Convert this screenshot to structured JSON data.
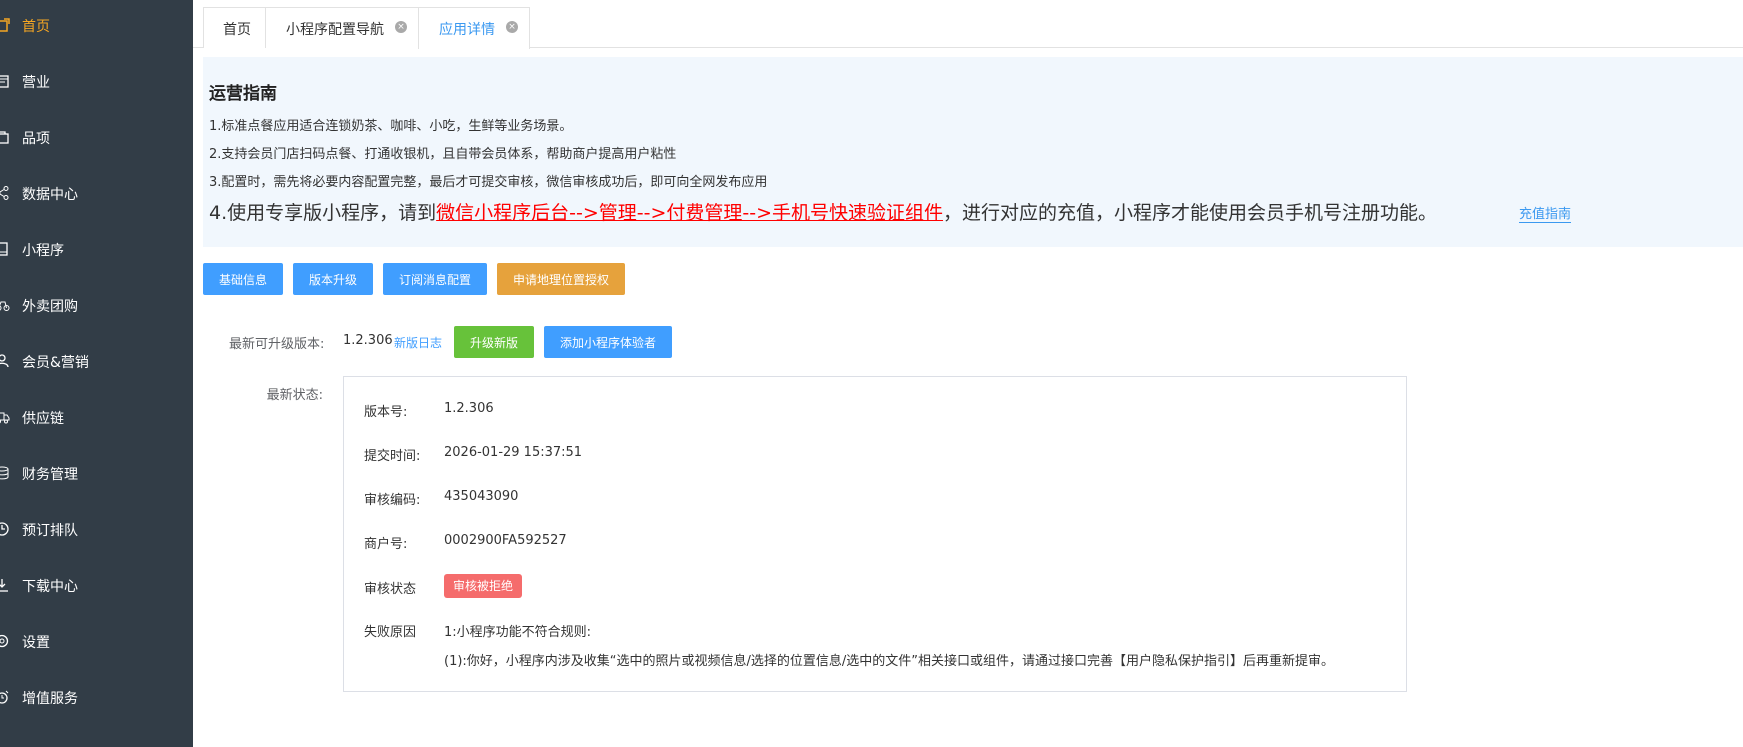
{
  "sidebar": {
    "items": [
      {
        "label": "首页",
        "icon": "home-icon",
        "active": true
      },
      {
        "label": "营业",
        "icon": "calendar-icon"
      },
      {
        "label": "品项",
        "icon": "bag-icon"
      },
      {
        "label": "数据中心",
        "icon": "share-icon"
      },
      {
        "label": "小程序",
        "icon": "phone-icon"
      },
      {
        "label": "外卖团购",
        "icon": "bike-icon"
      },
      {
        "label": "会员&营销",
        "icon": "user-icon"
      },
      {
        "label": "供应链",
        "icon": "truck-icon"
      },
      {
        "label": "财务管理",
        "icon": "coins-icon"
      },
      {
        "label": "预订排队",
        "icon": "clock-icon"
      },
      {
        "label": "下载中心",
        "icon": "download-icon"
      },
      {
        "label": "设置",
        "icon": "gear-icon"
      },
      {
        "label": "增值服务",
        "icon": "alarm-icon"
      }
    ]
  },
  "tabs": [
    {
      "label": "首页"
    },
    {
      "label": "小程序配置导航",
      "close": "×"
    },
    {
      "label": "应用详情",
      "close": "×"
    }
  ],
  "guide": {
    "title": "运营指南",
    "line1": "1.标准点餐应用适合连锁奶茶、咖啡、小吃，生鲜等业务场景。",
    "line2": "2.支持会员门店扫码点餐、打通收银机，且自带会员体系，帮助商户提高用户粘性",
    "line3": "3.配置时，需先将必要内容配置完整，最后才可提交审核，微信审核成功后，即可向全网发布应用",
    "line4_prefix": "4.使用专享版小程序，请到",
    "line4_red": "微信小程序后台-->管理-->付费管理-->手机号快速验证组件",
    "line4_suffix": "，进行对应的充值，小程序才能使用会员手机号注册功能。",
    "recharge_link": "充值指南"
  },
  "actions": {
    "basic_info": "基础信息",
    "version_upgrade": "版本升级",
    "subscribe_msg": "订阅消息配置",
    "apply_location": "申请地理位置授权"
  },
  "version": {
    "label": "最新可升级版本:",
    "value": "1.2.306",
    "changelog": "新版日志",
    "upgrade_btn": "升级新版",
    "add_tester_btn": "添加小程序体验者"
  },
  "status": {
    "label": "最新状态:",
    "version_no_k": "版本号:",
    "version_no_v": "1.2.306",
    "submit_time_k": "提交时间:",
    "submit_time_v": "2026-01-29 15:37:51",
    "audit_code_k": "审核编码:",
    "audit_code_v": "435043090",
    "merchant_k": "商户号:",
    "merchant_v": "0002900FA592527",
    "audit_status_k": "审核状态",
    "audit_status_v": "审核被拒绝",
    "fail_reason_k": "失败原因",
    "fail_reason_v1": "1:小程序功能不符合规则:",
    "fail_reason_v2": "(1):你好，小程序内涉及收集“选中的照片或视频信息/选择的位置信息/选中的文件”相关接口或组件，请通过接口完善【用户隐私保护指引】后再重新提审。"
  },
  "colors": {
    "sidebar_bg": "#323d47",
    "active": "#f5a623",
    "primary": "#409eff",
    "warning": "#e6a23c",
    "success": "#67c23a",
    "danger": "#f56c6c"
  }
}
